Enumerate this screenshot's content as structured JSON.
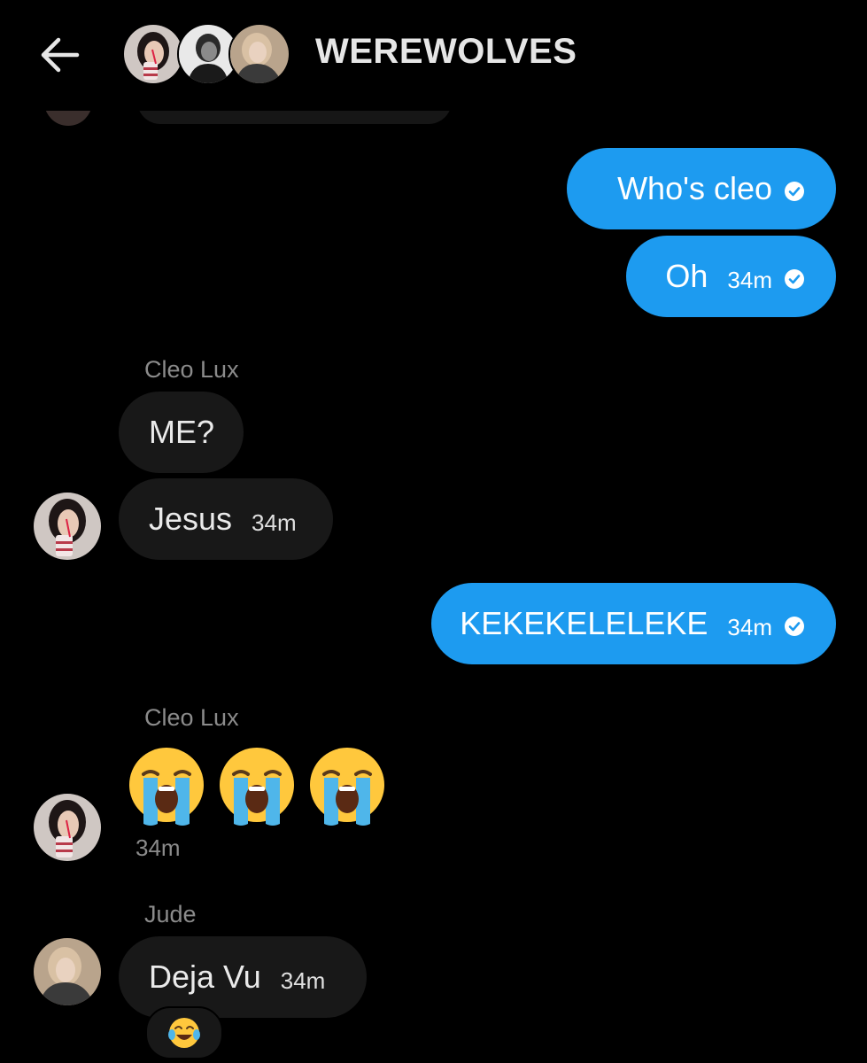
{
  "header": {
    "title": "WEREWOLVES",
    "back_icon": "arrow-left-icon",
    "avatar_icons": [
      "avatar-cleo-icon",
      "avatar-member-icon",
      "avatar-jude-icon"
    ]
  },
  "messages": [
    {
      "direction": "outgoing",
      "text": "Who's cleo",
      "time": "",
      "status_icon": "check-circle-icon"
    },
    {
      "direction": "outgoing",
      "text": "Oh",
      "time": "34m",
      "status_icon": "check-circle-icon"
    },
    {
      "direction": "incoming",
      "sender": "Cleo Lux",
      "text": "ME?"
    },
    {
      "direction": "incoming",
      "text": "Jesus",
      "time": "34m"
    },
    {
      "direction": "outgoing",
      "text": "KEKEKELELEKE",
      "time": "34m",
      "status_icon": "check-circle-icon"
    },
    {
      "direction": "incoming",
      "sender": "Cleo Lux",
      "emojis": [
        "loudly-crying-face",
        "loudly-crying-face",
        "loudly-crying-face"
      ],
      "time": "34m"
    },
    {
      "direction": "incoming",
      "sender": "Jude",
      "text": "Deja Vu",
      "time": "34m",
      "reaction": "face-with-tears-of-joy"
    }
  ],
  "colors": {
    "background": "#000000",
    "outgoing_bubble": "#1d9bf0",
    "incoming_bubble": "#181818",
    "sender_name": "#8b8b8b"
  }
}
